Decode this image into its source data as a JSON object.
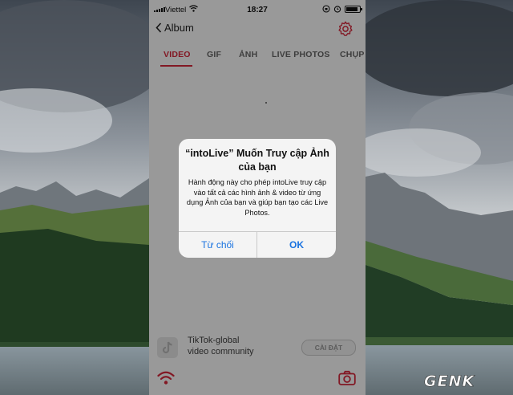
{
  "status_bar": {
    "carrier": "Viettel",
    "time": "18:27"
  },
  "nav": {
    "back_label": "Album",
    "back_icon": "chevron-left-icon",
    "settings_icon": "gear-icon"
  },
  "tabs": [
    {
      "label": "VIDEO",
      "active": true
    },
    {
      "label": "GIF",
      "active": false
    },
    {
      "label": "ẢNH",
      "active": false
    },
    {
      "label": "LIVE PHOTOS",
      "active": false
    },
    {
      "label": "CHỤP",
      "active": false
    }
  ],
  "alert": {
    "title": "“intoLive” Muốn Truy cập Ảnh của bạn",
    "message": "Hành động này cho phép intoLive truy cập vào tất cả các hình ảnh & video từ ứng dụng Ảnh của bạn và giúp bạn tạo các Live Photos.",
    "deny_label": "Từ chối",
    "ok_label": "OK"
  },
  "ad": {
    "title": "TikTok-global",
    "subtitle": "video community",
    "button": "CÀI ĐẶT"
  },
  "bottom_bar": {
    "left_icon": "wifi-icon",
    "right_icon": "camera-icon"
  },
  "battery_level": 0.9,
  "watermark": "GENK",
  "colors": {
    "accent": "#d9283c",
    "alert_button": "#1a73e0",
    "dim_overlay": "rgba(0,0,0,0.40)"
  }
}
